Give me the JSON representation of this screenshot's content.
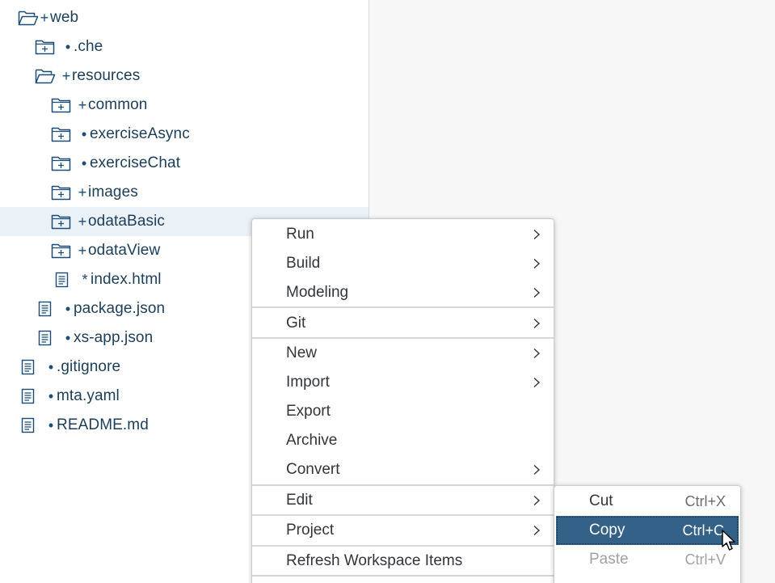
{
  "tree": {
    "items": [
      {
        "label": "web",
        "marker": "+",
        "icon": "folder-open-icon"
      },
      {
        "label": ".che",
        "marker": "•",
        "icon": "folder-closed-icon"
      },
      {
        "label": "resources",
        "marker": "+",
        "icon": "folder-open-icon"
      },
      {
        "label": "common",
        "marker": "+",
        "icon": "folder-closed-icon"
      },
      {
        "label": "exerciseAsync",
        "marker": "•",
        "icon": "folder-closed-icon"
      },
      {
        "label": "exerciseChat",
        "marker": "•",
        "icon": "folder-closed-icon"
      },
      {
        "label": "images",
        "marker": "+",
        "icon": "folder-closed-icon"
      },
      {
        "label": "odataBasic",
        "marker": "+",
        "icon": "folder-closed-icon",
        "selected": true
      },
      {
        "label": "odataView",
        "marker": "+",
        "icon": "folder-closed-icon"
      },
      {
        "label": "index.html",
        "marker": "*",
        "icon": "file-icon"
      },
      {
        "label": "package.json",
        "marker": "•",
        "icon": "file-icon"
      },
      {
        "label": "xs-app.json",
        "marker": "•",
        "icon": "file-icon"
      },
      {
        "label": ".gitignore",
        "marker": "•",
        "icon": "file-icon"
      },
      {
        "label": "mta.yaml",
        "marker": "•",
        "icon": "file-icon"
      },
      {
        "label": "README.md",
        "marker": "•",
        "icon": "file-icon"
      }
    ]
  },
  "context_menu": {
    "items": [
      {
        "label": "Run",
        "submenu": true
      },
      {
        "label": "Build",
        "submenu": true
      },
      {
        "label": "Modeling",
        "submenu": true
      },
      {
        "label": "Git",
        "submenu": true
      },
      {
        "label": "New",
        "submenu": true
      },
      {
        "label": "Import",
        "submenu": true
      },
      {
        "label": "Export",
        "submenu": false
      },
      {
        "label": "Archive",
        "submenu": false
      },
      {
        "label": "Convert",
        "submenu": true
      },
      {
        "label": "Edit",
        "submenu": true
      },
      {
        "label": "Project",
        "submenu": true
      },
      {
        "label": "Refresh Workspace Items",
        "submenu": false
      }
    ]
  },
  "edit_submenu": {
    "items": [
      {
        "label": "Cut",
        "shortcut": "Ctrl+X",
        "state": "normal"
      },
      {
        "label": "Copy",
        "shortcut": "Ctrl+C",
        "state": "active"
      },
      {
        "label": "Paste",
        "shortcut": "Ctrl+V",
        "state": "disabled"
      }
    ]
  },
  "colors": {
    "accent": "#346187",
    "tree_text": "#1c3e5a",
    "selection": "#eaf1f7"
  }
}
